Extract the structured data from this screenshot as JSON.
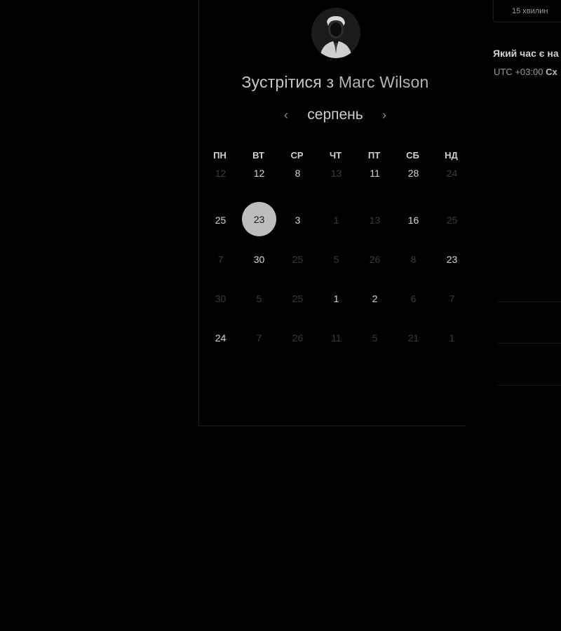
{
  "header": {
    "title_prefix": "Зустрітися з",
    "host_name": "Marc Wilson"
  },
  "calendar": {
    "month": "серпень",
    "prev_icon": "chevron-left-icon",
    "next_icon": "chevron-right-icon",
    "weekdays": [
      "ПН",
      "ВТ",
      "СР",
      "ЧТ",
      "ПТ",
      "СБ",
      "НД"
    ],
    "rows": [
      [
        {
          "d": "12",
          "s": "muted"
        },
        {
          "d": "12",
          "s": "active"
        },
        {
          "d": "8",
          "s": "active"
        },
        {
          "d": "13",
          "s": "muted"
        },
        {
          "d": "11",
          "s": "active"
        },
        {
          "d": "28",
          "s": "active"
        },
        {
          "d": "24",
          "s": "muted"
        }
      ],
      [
        {
          "d": "25",
          "s": "active"
        },
        {
          "d": "23",
          "s": "selected"
        },
        {
          "d": "3",
          "s": "active"
        },
        {
          "d": "1",
          "s": "muted"
        },
        {
          "d": "13",
          "s": "muted"
        },
        {
          "d": "16",
          "s": "active"
        },
        {
          "d": "25",
          "s": "muted"
        }
      ],
      [
        {
          "d": "7",
          "s": "muted"
        },
        {
          "d": "30",
          "s": "active"
        },
        {
          "d": "25",
          "s": "muted"
        },
        {
          "d": "5",
          "s": "muted"
        },
        {
          "d": "26",
          "s": "muted"
        },
        {
          "d": "8",
          "s": "muted"
        },
        {
          "d": "23",
          "s": "active"
        }
      ],
      [
        {
          "d": "30",
          "s": "muted"
        },
        {
          "d": "5",
          "s": "muted"
        },
        {
          "d": "25",
          "s": "muted"
        },
        {
          "d": "1",
          "s": "active"
        },
        {
          "d": "2",
          "s": "active"
        },
        {
          "d": "6",
          "s": "muted"
        },
        {
          "d": "7",
          "s": "muted"
        }
      ],
      [
        {
          "d": "24",
          "s": "active"
        },
        {
          "d": "7",
          "s": "muted"
        },
        {
          "d": "26",
          "s": "muted"
        },
        {
          "d": "11",
          "s": "muted"
        },
        {
          "d": "5",
          "s": "muted"
        },
        {
          "d": "21",
          "s": "muted"
        },
        {
          "d": "1",
          "s": "muted"
        }
      ]
    ]
  },
  "side_panel": {
    "duration": "15 хвилин",
    "question": "Який час є на",
    "timezone_offset": "UTC +03:00",
    "timezone_name": "Сх"
  },
  "colors": {
    "background": "#000000",
    "selected_day": "#bdbdbd",
    "muted_text": "#3b3b3b"
  }
}
